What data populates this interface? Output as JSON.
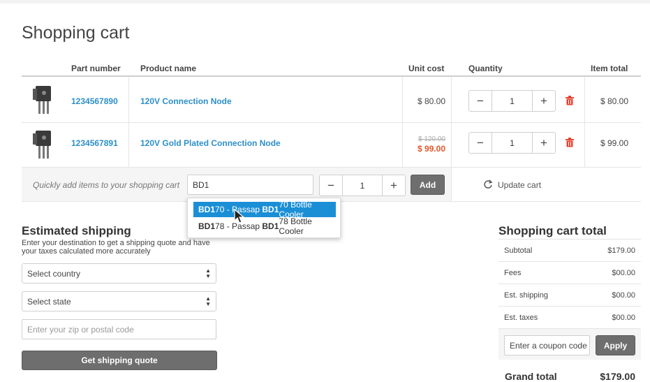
{
  "page": {
    "title": "Shopping cart"
  },
  "table": {
    "headers": {
      "part_number": "Part number",
      "product_name": "Product name",
      "unit_cost": "Unit cost",
      "quantity": "Quantity",
      "item_total": "Item total"
    },
    "rows": [
      {
        "part_number": "1234567890",
        "product_name": "120V Connection Node",
        "unit_cost": "$ 80.00",
        "quantity": "1",
        "item_total": "$ 80.00"
      },
      {
        "part_number": "1234567891",
        "product_name": "120V Gold Plated Connection Node",
        "old_cost": "$ 120.00",
        "unit_cost": "$ 99.00",
        "quantity": "1",
        "item_total": "$ 99.00"
      }
    ]
  },
  "quick_add": {
    "label": "Quickly add items to your shopping cart",
    "search_value": "BD1",
    "quantity": "1",
    "add_label": "Add",
    "update_label": "Update cart",
    "suggestions": [
      {
        "b1": "BD1",
        "t1": "70 - Passap ",
        "b2": "BD1",
        "t2": "70 Bottle Cooler"
      },
      {
        "b1": "BD1",
        "t1": "78 - Passap ",
        "b2": "BD1",
        "t2": "78 Bottle Cooler"
      }
    ]
  },
  "shipping": {
    "title": "Estimated shipping",
    "desc_line1": "Enter your destination to get a shipping quote and have",
    "desc_line2": "your taxes calculated more accurately",
    "country_label": "Select country",
    "state_label": "Select state",
    "zip_placeholder": "Enter your zip or postal code",
    "quote_label": "Get shipping quote"
  },
  "totals": {
    "title": "Shopping cart total",
    "rows": [
      {
        "label": "Subtotal",
        "value": "$179.00"
      },
      {
        "label": "Fees",
        "value": "$00.00"
      },
      {
        "label": "Est. shipping",
        "value": "$00.00"
      },
      {
        "label": "Est. taxes",
        "value": "$00.00"
      }
    ],
    "coupon_placeholder": "Enter a coupon code",
    "apply_label": "Apply",
    "grand_label": "Grand total",
    "grand_value": "$179.00"
  },
  "colors": {
    "link": "#2d8fc9",
    "sale": "#e2562b",
    "delete": "#e8432f",
    "highlight": "#1a8fd6"
  }
}
